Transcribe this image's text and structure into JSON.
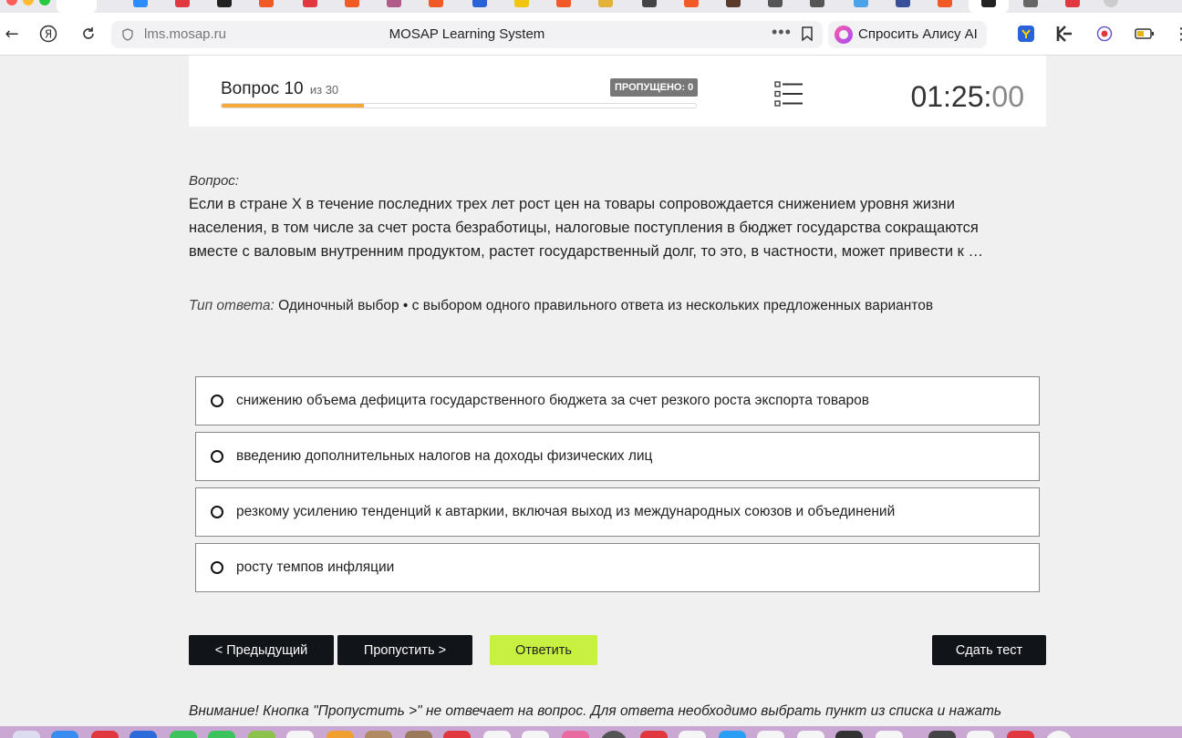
{
  "browser": {
    "url": "lms.mosap.ru",
    "page_title": "MOSAP Learning System",
    "alice_label": "Спросить Алису AI"
  },
  "quiz": {
    "question_prefix": "Вопрос 10",
    "question_of": "из 30",
    "skipped_badge": "ПРОПУЩЕНО: 0",
    "progress_fraction": 0.3,
    "timer_main": "01:25:",
    "timer_seconds": "00",
    "question_label": "Вопрос:",
    "question_text": "Если в стране X в течение последних трех лет рост цен на товары сопровождается снижением уровня жизни населения, в том числе за счет роста безработицы, налоговые поступления в бюджет государства сокращаются вместе с валовым внутренним продуктом, растет государственный долг, то это, в частности, может привести к …",
    "answer_type_label": "Тип ответа:",
    "answer_type_value": "Одиночный выбор • с выбором одного правильного ответа из нескольких предложенных вариантов",
    "options": [
      "снижению объема дефицита государственного бюджета за счет резкого роста экспорта товаров",
      "введению дополнительных налогов на доходы физических лиц",
      "резкому усилению тенденций к автаркии, включая выход из международных союзов и объединений",
      "росту темпов инфляции"
    ],
    "buttons": {
      "prev": "< Предыдущий",
      "skip": "Пропустить >",
      "answer": "Ответить",
      "submit": "Сдать тест"
    },
    "notice": "Внимание! Кнопка \"Пропустить >\" не отвечает на вопрос. Для ответа необходимо выбрать пункт из списка и нажать"
  },
  "colors": {
    "progress": "#f5a93a",
    "answer_button": "#c8f040",
    "dark_button": "#111418"
  }
}
